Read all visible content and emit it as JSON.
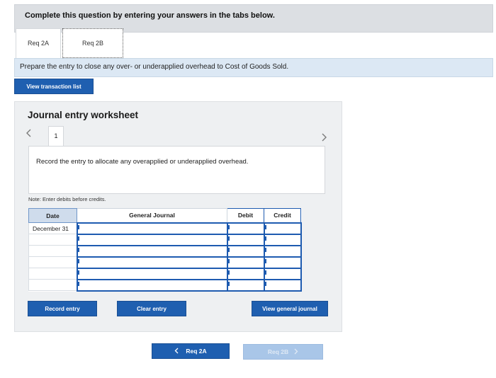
{
  "instructions": "Complete this question by entering your answers in the tabs below.",
  "tabs": [
    {
      "label": "Req 2A"
    },
    {
      "label": "Req 2B"
    }
  ],
  "prompt": "Prepare the entry to close any over- or underapplied overhead to Cost of Goods Sold.",
  "view_transaction_list_label": "View transaction list",
  "worksheet": {
    "title": "Journal entry worksheet",
    "prev_icon": "chevron-left-icon",
    "next_icon": "chevron-right-icon",
    "step_number": "1",
    "record_instruction": "Record the entry to allocate any overapplied or underapplied overhead.",
    "note": "Note: Enter debits before credits.",
    "table": {
      "headers": {
        "date": "Date",
        "general_journal": "General Journal",
        "debit": "Debit",
        "credit": "Credit"
      },
      "rows": [
        {
          "date": "December 31",
          "general_journal": "",
          "debit": "",
          "credit": ""
        },
        {
          "date": "",
          "general_journal": "",
          "debit": "",
          "credit": ""
        },
        {
          "date": "",
          "general_journal": "",
          "debit": "",
          "credit": ""
        },
        {
          "date": "",
          "general_journal": "",
          "debit": "",
          "credit": ""
        },
        {
          "date": "",
          "general_journal": "",
          "debit": "",
          "credit": ""
        },
        {
          "date": "",
          "general_journal": "",
          "debit": "",
          "credit": ""
        }
      ]
    },
    "record_entry_label": "Record entry",
    "clear_entry_label": "Clear entry",
    "view_general_journal_label": "View general journal"
  },
  "bottom_nav": {
    "prev_label": "Req 2A",
    "next_label": "Req 2B"
  },
  "colors": {
    "accent": "#1f5fb0",
    "disabled": "#a9c6e8",
    "prompt_bg": "#dce8f4",
    "header_bg": "#dcdfe3"
  }
}
